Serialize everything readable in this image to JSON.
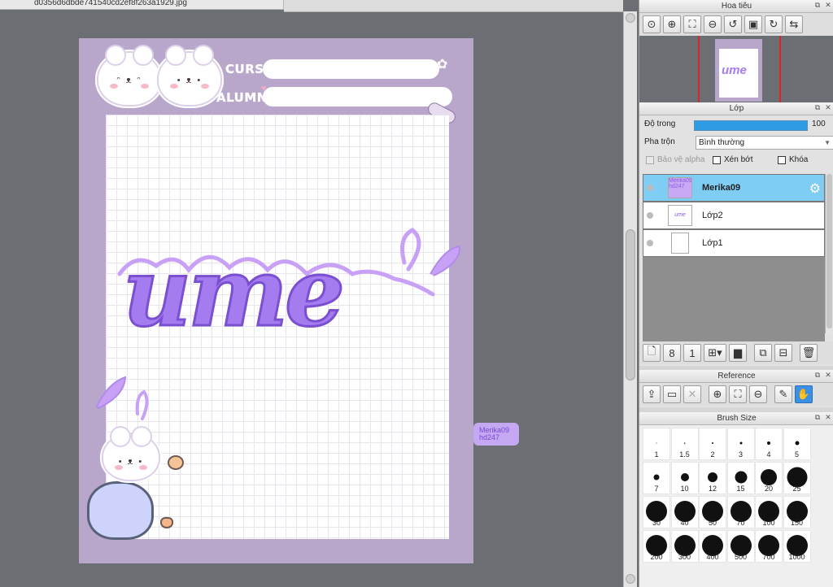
{
  "file_tab": {
    "filename": "d0356d6dbde741540cd2ef8f263a1929.jpg"
  },
  "artwork": {
    "labels": {
      "curso": "CURSO:",
      "alumna": "ALUMNA:"
    },
    "title_word": "ume",
    "watermark": {
      "line1": "Merika09",
      "line2": "hd247"
    },
    "colors": {
      "frame": "#b9a7cb",
      "lettering": "#a57cf0",
      "paper": "#ffffff"
    }
  },
  "navigator": {
    "title": "Hoa tiêu",
    "tools": [
      "zoom-actual-icon",
      "zoom-in-icon",
      "fit-icon",
      "zoom-out-icon",
      "rotate-left-icon",
      "rotate-reset-icon",
      "rotate-right-icon",
      "flip-icon"
    ]
  },
  "layers": {
    "title": "Lớp",
    "opacity_label": "Độ trong",
    "opacity_value": "100 %",
    "opacity_fraction": 1.0,
    "blend_label": "Pha trộn",
    "blend_value": "Bình thường",
    "protect_alpha": "Bảo vệ alpha",
    "clipping": "Xén bớt",
    "lock": "Khóa",
    "items": [
      {
        "name": "Merika09",
        "thumb_text": "Merika09 hd247",
        "selected": true
      },
      {
        "name": "Lớp2",
        "thumb_text": "ume",
        "selected": false
      },
      {
        "name": "Lớp1",
        "thumb_text": "",
        "selected": false
      }
    ]
  },
  "reference": {
    "title": "Reference"
  },
  "brush_size": {
    "title": "Brush Size",
    "sizes": [
      "1",
      "1.5",
      "2",
      "3",
      "4",
      "5",
      "7",
      "10",
      "12",
      "15",
      "20",
      "25",
      "30",
      "40",
      "50",
      "70",
      "100",
      "150",
      "200",
      "300",
      "400",
      "500",
      "700",
      "1000"
    ]
  },
  "accent_color": "#3a8fe6"
}
